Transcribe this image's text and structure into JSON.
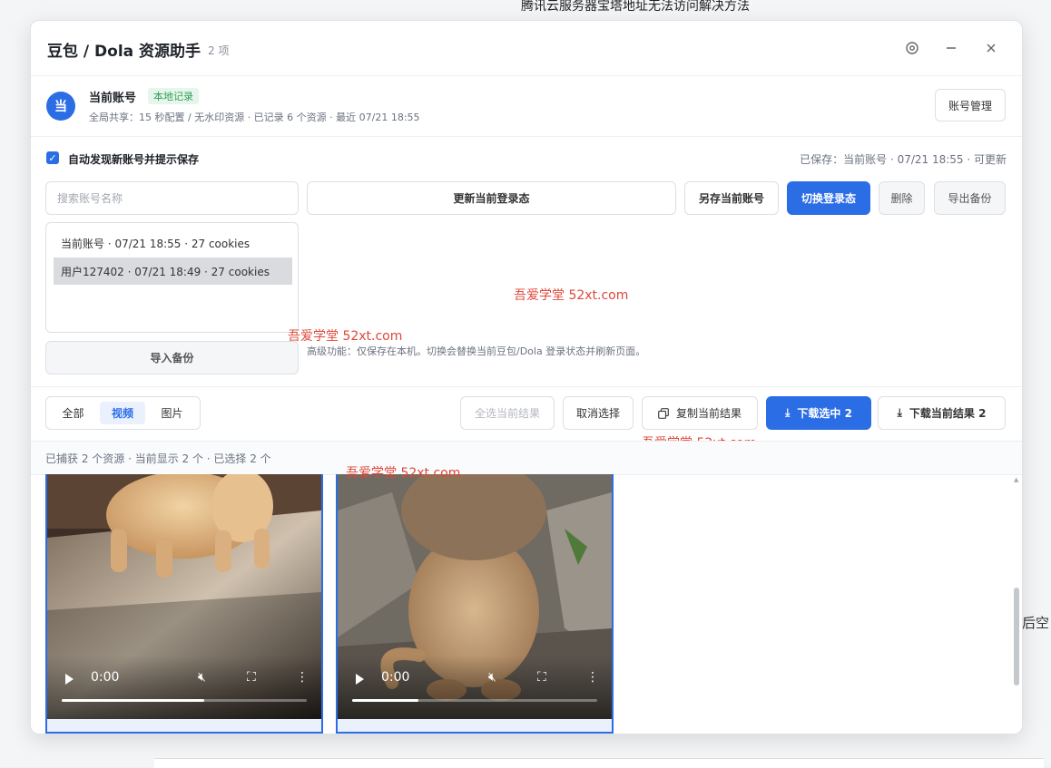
{
  "background": {
    "page_title": "腾讯云服务器宝塔地址无法访问解决方法",
    "right_fragment": "后空"
  },
  "header": {
    "title": "豆包 / Dola 资源助手",
    "count": "2 项"
  },
  "account": {
    "avatar": "当",
    "name": "当前账号",
    "badge": "本地记录",
    "meta": "全局共享：15 秒配置 / 无水印资源 · 已记录 6 个资源 · 最近 07/21 18:55",
    "manage_label": "账号管理"
  },
  "auto": {
    "checked": true,
    "label": "自动发现新账号并提示保存",
    "saved": "已保存：当前账号 · 07/21 18:55 · 可更新"
  },
  "search": {
    "placeholder": "搜索账号名称"
  },
  "actions": {
    "update": "更新当前登录态",
    "save_as": "另存当前账号",
    "switch": "切换登录态",
    "delete": "删除",
    "export": "导出备份",
    "import": "导入备份"
  },
  "accounts": [
    {
      "label": "当前账号 · 07/21 18:55 · 27 cookies",
      "selected": false
    },
    {
      "label": "用户127402 · 07/21 18:49 · 27 cookies",
      "selected": true
    }
  ],
  "hint": "高级功能：仅保存在本机。切换会替换当前豆包/Dola 登录状态并刷新页面。",
  "watermark": "吾爱学堂 52xt.com",
  "filter": {
    "tabs": [
      {
        "label": "全部",
        "active": false
      },
      {
        "label": "视频",
        "active": true
      },
      {
        "label": "图片",
        "active": false
      }
    ],
    "select_all": "全选当前结果",
    "cancel": "取消选择",
    "copy": "复制当前结果",
    "download_selected": "下载选中 2",
    "download_current": "下载当前结果 2"
  },
  "status": "已捕获 2 个资源 · 当前显示 2 个 · 已选择 2 个",
  "videos": [
    {
      "subject": "cat",
      "time": "0:00",
      "progress": 0.58
    },
    {
      "subject": "monkey",
      "time": "0:00",
      "progress": 0.27
    }
  ],
  "icons": [
    "settings-icon",
    "minimize-icon",
    "close-icon",
    "copy-icon",
    "download-icon",
    "play-icon",
    "mute-icon",
    "fullscreen-icon",
    "more-icon"
  ],
  "colors": {
    "accent": "#2b6de5",
    "badge_green": "#2f9e57",
    "watermark_red": "#e0473a"
  }
}
